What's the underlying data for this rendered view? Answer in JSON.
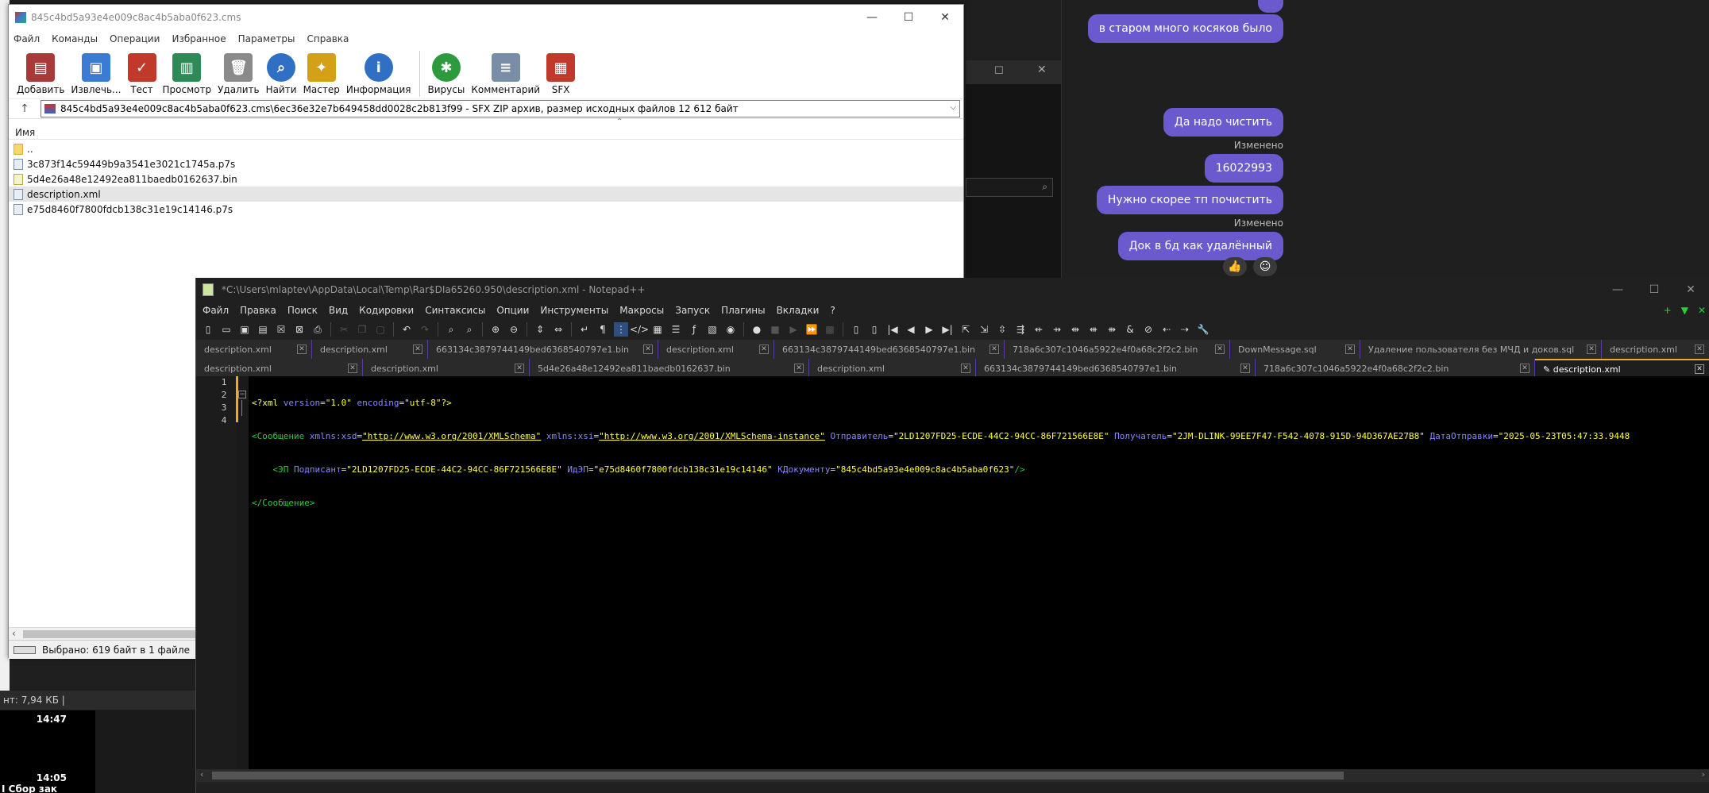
{
  "chat": {
    "messages": [
      {
        "text": "в старом много косяков было"
      },
      {
        "text": "Да надо чистить"
      },
      {
        "text": "16022993"
      },
      {
        "text": "Нужно скорее тп почистить"
      },
      {
        "text": "Док в бд как удалённый"
      }
    ],
    "edited_label": "Изменено",
    "reactions": [
      "👍",
      "☺"
    ]
  },
  "background": {
    "status_text": "нт: 7,94 КБ  |",
    "time1": "14:47",
    "time2": "14:05",
    "snippet": "І Сбор зак"
  },
  "rar": {
    "title": "845c4bd5a93e4e009c8ac4b5aba0f623.cms",
    "menu": [
      "Файл",
      "Команды",
      "Операции",
      "Избранное",
      "Параметры",
      "Справка"
    ],
    "tools": [
      {
        "label": "Добавить",
        "icon": "add-archive-icon",
        "color": "#a83a3a"
      },
      {
        "label": "Извлечь...",
        "icon": "extract-icon",
        "color": "#3b7bd4"
      },
      {
        "label": "Тест",
        "icon": "test-icon",
        "color": "#c0392b"
      },
      {
        "label": "Просмотр",
        "icon": "view-icon",
        "color": "#2e8b57"
      },
      {
        "label": "Удалить",
        "icon": "delete-icon",
        "color": "#8a8a8a"
      },
      {
        "label": "Найти",
        "icon": "find-icon",
        "color": "#2f6fc4"
      },
      {
        "label": "Мастер",
        "icon": "wizard-icon",
        "color": "#d4a017"
      },
      {
        "label": "Информация",
        "icon": "info-icon",
        "color": "#2f6fc4"
      },
      {
        "label": "Вирусы",
        "icon": "virus-scan-icon",
        "color": "#2e9a3e"
      },
      {
        "label": "Комментарий",
        "icon": "comment-icon",
        "color": "#7a8da6"
      },
      {
        "label": "SFX",
        "icon": "sfx-icon",
        "color": "#c0392b"
      }
    ],
    "path": "845c4bd5a93e4e009c8ac4b5aba0f623.cms\\6ec36e32e7b649458dd0028c2b813f99 - SFX ZIP архив, размер исходных файлов 12 612 байт",
    "column_name": "Имя",
    "files": [
      {
        "name": "..",
        "type": "folder"
      },
      {
        "name": "3c873f14c59449b9a3541e3021c1745a.p7s",
        "type": "file"
      },
      {
        "name": "5d4e26a48e12492ea811baedb0162637.bin",
        "type": "bin"
      },
      {
        "name": "description.xml",
        "type": "file"
      },
      {
        "name": "e75d8460f7800fdcb138c31e19c14146.p7s",
        "type": "file"
      }
    ],
    "status": "Выбрано: 619 байт в 1 файле"
  },
  "npp": {
    "title": "*C:\\Users\\mlaptev\\AppData\\Local\\Temp\\Rar$DIa65260.950\\description.xml - Notepad++",
    "menu": [
      "Файл",
      "Правка",
      "Поиск",
      "Вид",
      "Кодировки",
      "Синтаксисы",
      "Опции",
      "Инструменты",
      "Макросы",
      "Запуск",
      "Плагины",
      "Вкладки",
      "?"
    ],
    "menu_right": [
      "+",
      "▼",
      "✕"
    ],
    "tabs_row1": [
      {
        "label": "description.xml",
        "w": 146
      },
      {
        "label": "description.xml",
        "w": 146
      },
      {
        "label": "663134c3879744149bed6368540797e1.bin",
        "w": 290
      },
      {
        "label": "description.xml",
        "w": 146
      },
      {
        "label": "663134c3879744149bed6368540797e1.bin",
        "w": 290
      },
      {
        "label": "718a6c307c1046a5922e4f0a68c2f2c2.bin",
        "w": 284
      },
      {
        "label": "DownMessage.sql",
        "w": 164
      },
      {
        "label": "Удаление пользователя без МЧД и доков.sql",
        "w": 304
      },
      {
        "label": "description.xml",
        "w": 136
      }
    ],
    "tabs_row2": [
      {
        "label": "description.xml",
        "w": 210
      },
      {
        "label": "description.xml",
        "w": 210
      },
      {
        "label": "5d4e26a48e12492ea811baedb0162637.bin",
        "w": 352
      },
      {
        "label": "description.xml",
        "w": 210
      },
      {
        "label": "663134c3879744149bed6368540797e1.bin",
        "w": 352
      },
      {
        "label": "718a6c307c1046a5922e4f0a68c2f2c2.bin",
        "w": 352
      },
      {
        "label": "description.xml",
        "w": 220,
        "active": true
      }
    ],
    "line_numbers": [
      "1",
      "2",
      "3",
      "4"
    ],
    "code": {
      "l1_decl_open": "<?xml ",
      "l1_attr1": "version",
      "l1_val1": "\"1.0\"",
      "l1_attr2": " encoding",
      "l1_val2": "\"utf-8\"",
      "l1_close": "?>",
      "l2_tag": "<Сообщение",
      "l2_a1": " xmlns:xsd",
      "l2_v1": "\"http://www.w3.org/2001/XMLSchema\"",
      "l2_a2": " xmlns:xsi",
      "l2_v2": "\"http://www.w3.org/2001/XMLSchema-instance\"",
      "l2_a3": " Отправитель",
      "l2_v3": "\"2LD1207FD25-ECDE-44C2-94CC-86F721566E8E\"",
      "l2_a4": " Получатель",
      "l2_v4": "\"2JM-DLINK-99EE7F47-F542-4078-915D-94D367AE27B8\"",
      "l2_a5": " ДатаОтправки",
      "l2_v5": "\"2025-05-23T05:47:33.9448",
      "l3_tag": "    <ЭП",
      "l3_a1": " Подписант",
      "l3_v1": "\"2LD1207FD25-ECDE-44C2-94CC-86F721566E8E\"",
      "l3_a2": " ИдЭП",
      "l3_v2": "\"e75d8460f7800fdcb138c31e19c14146\"",
      "l3_a3": " КДокументу",
      "l3_v3": "\"845c4bd5a93e4e009c8ac4b5aba0f623\"",
      "l3_close": "/>",
      "l4_tag": "</Сообщение>"
    }
  }
}
